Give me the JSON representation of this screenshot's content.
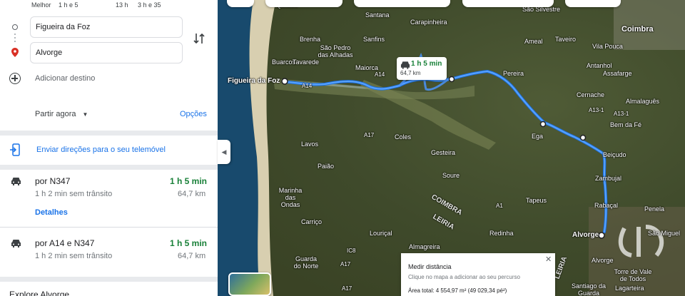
{
  "modes": {
    "best": "Melhor",
    "drive": "1 h e 5",
    "transit": "13 h",
    "walk": "3 h e 35"
  },
  "origin": {
    "value": "Figueira da Foz"
  },
  "destination": {
    "value": "Alvorge"
  },
  "add_destination": "Adicionar destino",
  "depart_label": "Partir agora",
  "options_label": "Opções",
  "send_directions": "Enviar direções para o seu telemóvel",
  "routes": [
    {
      "name": "por N347",
      "duration": "1 h 5 min",
      "traffic": "1 h 2 min sem trânsito",
      "distance": "64,7 km",
      "details": "Detalhes"
    },
    {
      "name": "por A14 e N347",
      "duration": "1 h 5 min",
      "traffic": "1 h 2 min sem trânsito",
      "distance": "64,7 km"
    }
  ],
  "explore": "Explore Alvorge",
  "map": {
    "bubble": {
      "duration": "1 h 5 min",
      "distance": "64,7 km"
    },
    "measure": {
      "title": "Medir distância",
      "hint": "Clique no mapa a adicionar ao seu percurso",
      "area": "Área total: 4 554,97 m² (49 029,34 pé²)"
    },
    "places": [
      "Quiaios",
      "Santana",
      "Carapinheira",
      "São Silvestre",
      "Coimbra",
      "Brenha",
      "Sanfins",
      "Ameal",
      "Taveiro",
      "Vila Pouca",
      "Buarcos",
      "Tavarede",
      "São Pedro das Alhadas",
      "Maiorca",
      "Antanhol",
      "Assafarge",
      "Figueira da Foz",
      "Pereira",
      "Cernache",
      "Almalaguês",
      "Bem da Fé",
      "A13-1",
      "A13-1",
      "Ega",
      "Beiçudo",
      "A14",
      "A14",
      "A17",
      "A17",
      "Coles",
      "Lavos",
      "Gesteira",
      "Paião",
      "Soure",
      "Zambujal",
      "Marinha das Ondas",
      "Tapeus",
      "COIMBRA",
      "LEIRIA",
      "A1",
      "Rabaçal",
      "Penela",
      "Carriço",
      "Louriçal",
      "Redinha",
      "Alvorge",
      "São Miguel",
      "Guarda do Norte",
      "Almagreira",
      "IC8",
      "Alvorge",
      "Torre de Vale de Todos",
      "Lagarteira",
      "Santiago da Guarda",
      "A17",
      "LEIRIA"
    ],
    "accent": "#4285f4"
  }
}
